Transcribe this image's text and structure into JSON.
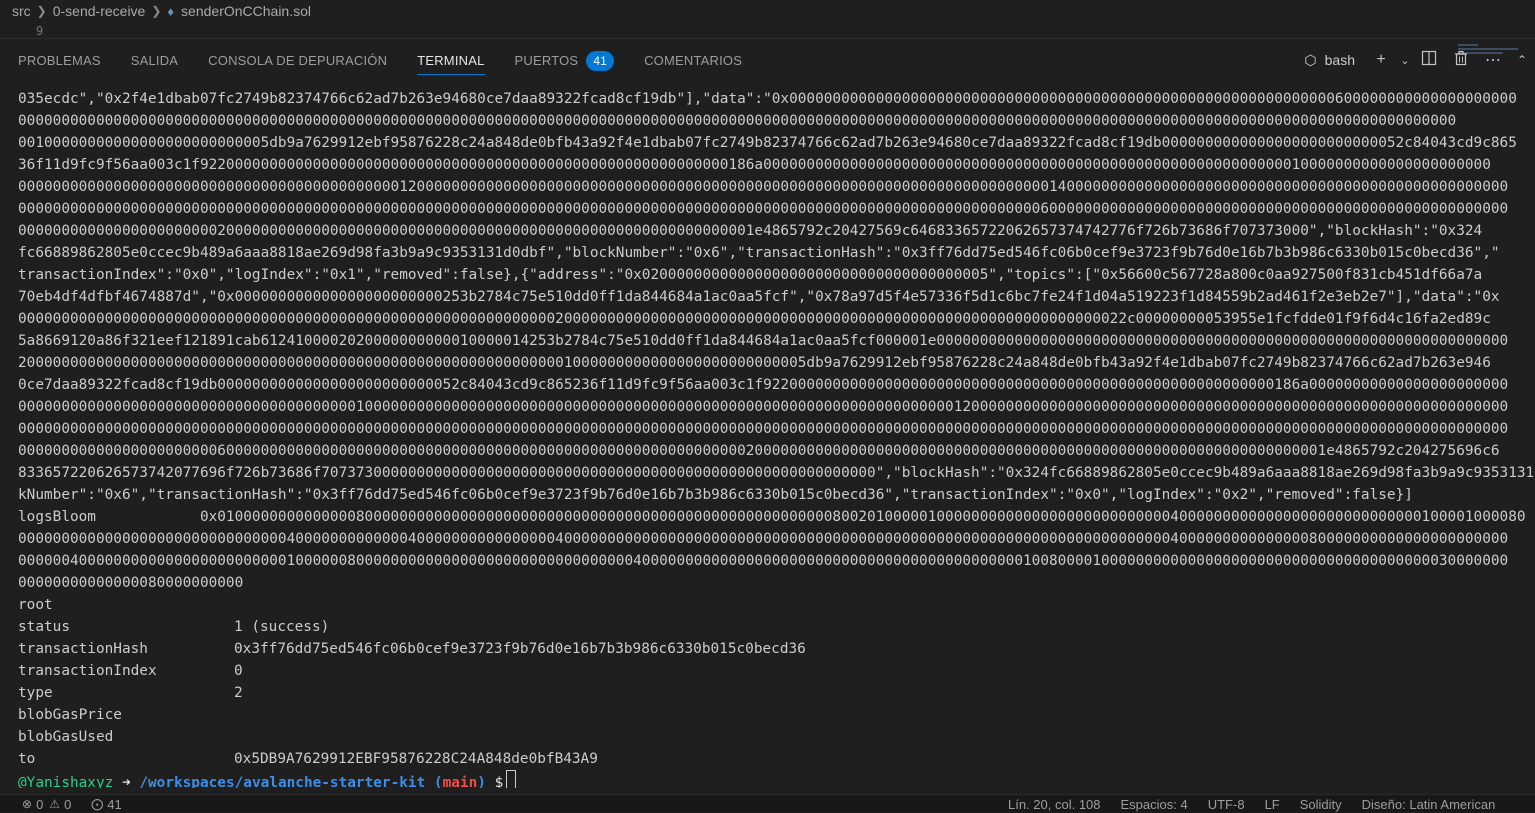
{
  "breadcrumb": {
    "items": [
      "src",
      "0-send-receive",
      "senderOnCChain.sol"
    ],
    "file_icon": "ethereum-icon"
  },
  "editor_peek": {
    "line_number": "9"
  },
  "panel": {
    "tabs": [
      {
        "label": "PROBLEMAS"
      },
      {
        "label": "SALIDA"
      },
      {
        "label": "CONSOLA DE DEPURACIÓN"
      },
      {
        "label": "TERMINAL",
        "active": true
      },
      {
        "label": "PUERTOS",
        "badge": "41"
      },
      {
        "label": "COMENTARIOS"
      }
    ],
    "shell_label": "bash",
    "actions": [
      "add-terminal-icon",
      "chevron-down-icon",
      "split-terminal-icon",
      "trash-icon",
      "more-icon",
      "chevron-up-icon"
    ]
  },
  "terminal": {
    "lines": [
      "035ecdc\",\"0x2f4e1dbab07fc2749b82374766c62ad7b263e94680ce7daa89322fcad8cf19db\"],\"data\":\"0x000000000000000000000000000000000000000000000000000000000000000600000000000000000000",
      "0000000000000000000000000000000000000000000000000000000000000000000000000000000000000000000000000000000000000000000000000000000000000000000000000000000000000000000000",
      "00100000000000000000000000005db9a7629912ebf95876228c24a848de0bfb43a92f4e1dbab07fc2749b82374766c62ad7b263e94680ce7daa89322fcad8cf19db0000000000000000000000000052c84043cd9c865",
      "36f11d9fc9f56aa003c1f9220000000000000000000000000000000000000000000000000000000000186a000000000000000000000000000000000000000000000000000000000000010000000000000000000000",
      "0000000000000000000000000000000000000000000012000000000000000000000000000000000000000000000000000000000000000000000000014000000000000000000000000000000000000000000000000000",
      "0000000000000000000000000000000000000000000000000000000000000000000000000000000000000000000000000000000000000000000000600000000000000000000000000000000000000000000000000000",
      "0000000000000000000000020000000000000000000000000000000000000000000000000000000000001e4865792c20427569c64683365722062657374742776f726b73686f707373000\",\"blockHash\":\"0x324",
      "fc66889862805e0ccec9b489a6aaa8818ae269d98fa3b9a9c9353131d0dbf\",\"blockNumber\":\"0x6\",\"transactionHash\":\"0x3ff76dd75ed546fc06b0cef9e3723f9b76d0e16b7b3b986c6330b015c0becd36\",\"",
      "transactionIndex\":\"0x0\",\"logIndex\":\"0x1\",\"removed\":false},{\"address\":\"0x0200000000000000000000000000000000000005\",\"topics\":[\"0x56600c567728a800c0aa927500f831cb451df66a7a",
      "70eb4df4dfbf4674887d\",\"0x000000000000000000000000253b2784c75e510dd0ff1da844684a1ac0aa5fcf\",\"0x78a97d5f4e57336f5d1c6bc7fe24f1d04a519223f1d84559b2ad461f2e3eb2e7\"],\"data\":\"0x",
      "00000000000000000000000000000000000000000000000000000000000000200000000000000000000000000000000000000000000000000000000000000022c00000000053955e1fcfdde01f9f6d4c16fa2ed89c",
      "5a8669120a86f321eef121891cab6124100002020000000000010000014253b2784c75e510dd0ff1da844684a1ac0aa5fcf000001e000000000000000000000000000000000000000000000000000000000000000000",
      "2000000000000000000000000000000000000000000000000000000000000001000000000000000000000000005db9a7629912ebf95876228c24a848de0bfb43a92f4e1dbab07fc2749b82374766c62ad7b263e946",
      "0ce7daa89322fcad8cf19db0000000000000000000000000052c84043cd9c865236f11d9fc9f56aa003c1f92200000000000000000000000000000000000000000000000000000000186a00000000000000000000000",
      "0000000000000000000000000000000000000001000000000000000000000000000000000000000000000000000000000000000000001200000000000000000000000000000000000000000000000000000000000000",
      "0000000000000000000000000000000000000000000000000000000000000000000000000000000000000000000000000000000000000000000000000000000000000000000000000000000000000000000000000000",
      "0000000000000000000000060000000000000000000000000000000000000000000000000000000000002000000000000000000000000000000000000000000000000000000000000000001e4865792c204275696c6",
      "833657220626573742077696f726b73686f7073730000000000000000000000000000000000000000000000000000000000\",\"blockHash\":\"0x324fc66889862805e0ccec9b489a6aaa8818ae269d98fa3b9a9c9353131d0dbf\",\"bloc",
      "kNumber\":\"0x6\",\"transactionHash\":\"0x3ff76dd75ed546fc06b0cef9e3723f9b76d0e16b7b3b986c6330b015c0becd36\",\"transactionIndex\":\"0x0\",\"logIndex\":\"0x2\",\"removed\":false}]",
      "logsBloom            0x0100000000000000800000000000000000000000000000000000000000000000000000080020100000100000000000000000000000000040000000000000000000000000000100001000080",
      "0000000000000000000000000000000400000000000004000000000000000040000000000000000000000000000000000000000000000000000000000000000000000400000000000000080000000000000000000000",
      "0000004000000000000000000000000100000080000000000000000000000000000000040000000000000000000000000000000000000000000010080000100000000000000000000000000000000000000030000000",
      "00000000000000080000000000"
    ],
    "fields": [
      {
        "key": "root",
        "value": ""
      },
      {
        "key": "status",
        "value": "1 (success)"
      },
      {
        "key": "transactionHash",
        "value": "0x3ff76dd75ed546fc06b0cef9e3723f9b76d0e16b7b3b986c6330b015c0becd36"
      },
      {
        "key": "transactionIndex",
        "value": "0"
      },
      {
        "key": "type",
        "value": "2"
      },
      {
        "key": "blobGasPrice",
        "value": ""
      },
      {
        "key": "blobGasUsed",
        "value": ""
      },
      {
        "key": "to",
        "value": "0x5DB9A7629912EBF95876228C24A848de0bfB43A9"
      }
    ],
    "prompt": {
      "user": "@Yanishaxyz",
      "arrow": "➜",
      "path": "/workspaces/avalanche-starter-kit",
      "git_open": "(",
      "branch": "main",
      "git_close": ")",
      "dollar": "$"
    }
  },
  "statusbar": {
    "errors": "0",
    "warnings": "0",
    "ports": "41",
    "position": "Lín. 20, col. 108",
    "spaces": "Espacios: 4",
    "encoding": "UTF-8",
    "eol": "LF",
    "language": "Solidity",
    "layout": "Diseño: Latin American"
  },
  "colors": {
    "background": "#1f1f1f",
    "accent": "#0078d4",
    "prompt_user": "#23d18b",
    "prompt_path": "#3b8eea",
    "prompt_branch": "#f14c4c"
  }
}
